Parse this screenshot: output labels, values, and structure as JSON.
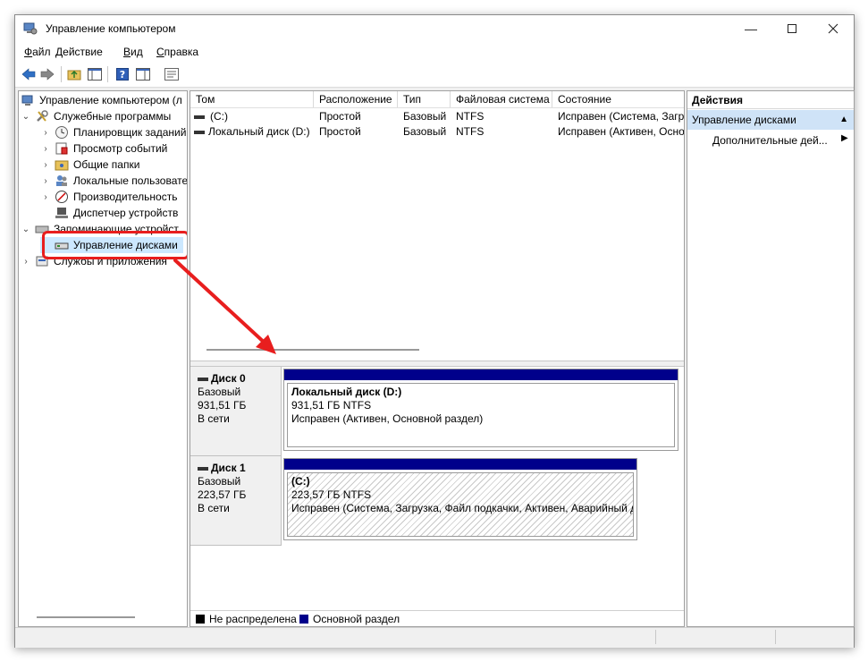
{
  "window": {
    "title": "Управление компьютером"
  },
  "menu": [
    {
      "prefix": "",
      "accel": "Ф",
      "rest": "айл"
    },
    {
      "prefix": "",
      "accel": "Д",
      "rest": "ействие"
    },
    {
      "prefix": "",
      "accel": "В",
      "rest": "ид"
    },
    {
      "prefix": "",
      "accel": "С",
      "rest": "правка"
    }
  ],
  "tree": {
    "root": "Управление компьютером (л",
    "services": "Служебные программы",
    "scheduler": "Планировщик заданий",
    "events": "Просмотр событий",
    "shared": "Общие папки",
    "users": "Локальные пользовате",
    "perf": "Производительность",
    "devmgr": "Диспетчер устройств",
    "storage": "Запоминающие устройст",
    "diskmgmt": "Управление дисками",
    "svcapps": "Службы и приложения"
  },
  "columns": [
    "Том",
    "Расположение",
    "Тип",
    "Файловая система",
    "Состояние"
  ],
  "volumes": [
    {
      "name": "(C:)",
      "layout": "Простой",
      "type": "Базовый",
      "fs": "NTFS",
      "status": "Исправен (Система, Загр"
    },
    {
      "name": "Локальный диск (D:)",
      "layout": "Простой",
      "type": "Базовый",
      "fs": "NTFS",
      "status": "Исправен (Активен, Осно"
    }
  ],
  "disks": [
    {
      "title": "Диск 0",
      "kind": "Базовый",
      "size": "931,51 ГБ",
      "state": "В сети",
      "part_name": "Локальный диск  (D:)",
      "part_size": "931,51 ГБ NTFS",
      "part_status": "Исправен (Активен, Основной раздел)"
    },
    {
      "title": "Диск 1",
      "kind": "Базовый",
      "size": "223,57 ГБ",
      "state": "В сети",
      "part_name": "(C:)",
      "part_size": "223,57 ГБ NTFS",
      "part_status": "Исправен (Система, Загрузка, Файл подкачки, Активен, Аварийный д"
    }
  ],
  "legend": [
    {
      "label": "Не распределена",
      "color": "#000000"
    },
    {
      "label": "Основной раздел",
      "color": "#00008b"
    }
  ],
  "actions": {
    "header": "Действия",
    "section": "Управление дисками",
    "more": "Дополнительные дей..."
  },
  "colors": {
    "highlight": "#e81e1e",
    "partition": "#00008b",
    "selection": "#cce8ff"
  }
}
